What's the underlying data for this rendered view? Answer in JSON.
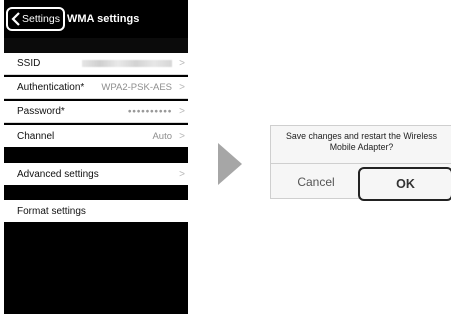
{
  "nav": {
    "back_label": "Settings",
    "title": "WMA settings"
  },
  "settings": {
    "ssid_label": "SSID",
    "authentication_label": "Authentication*",
    "authentication_value": "WPA2-PSK-AES",
    "password_label": "Password*",
    "password_value": "●●●●●●●●●●",
    "channel_label": "Channel",
    "channel_value": "Auto",
    "advanced_label": "Advanced settings",
    "format_label": "Format settings",
    "chevron": ">"
  },
  "dialog": {
    "message_line1": "Save changes and restart the Wireless",
    "message_line2": "Mobile Adapter?",
    "cancel_label": "Cancel",
    "ok_label": "OK"
  },
  "icons": {
    "back": "chevron-left-icon",
    "row_chevron": "chevron-right-icon",
    "transition": "arrow-right-icon"
  },
  "colors": {
    "screen_bg": "#000000",
    "row_bg": "#ffffff",
    "value_text": "#8e8e8e",
    "dialog_bg": "#f6f6f6"
  }
}
